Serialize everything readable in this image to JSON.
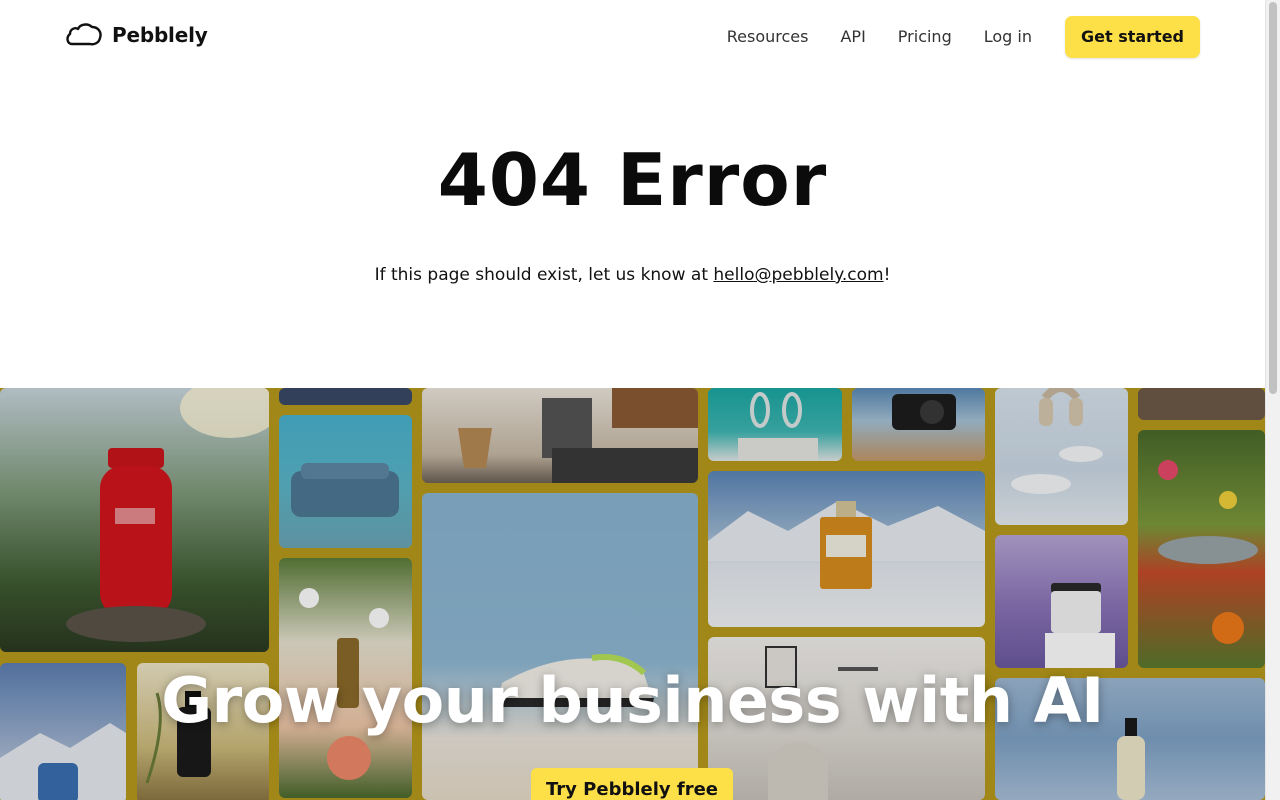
{
  "brand": {
    "name": "Pebblely",
    "icon": "pebble-icon"
  },
  "nav": {
    "links": [
      "Resources",
      "API",
      "Pricing",
      "Log in"
    ],
    "cta": "Get started"
  },
  "error": {
    "title": "404 Error",
    "message_prefix": "If this page should exist, let us know at ",
    "email": "hello@pebblely.com",
    "message_suffix": "!"
  },
  "hero": {
    "title": "Grow your business with AI",
    "button": "Try Pebblely free"
  },
  "colors": {
    "accent": "#fde047",
    "tile_background": "#b89a1c"
  }
}
